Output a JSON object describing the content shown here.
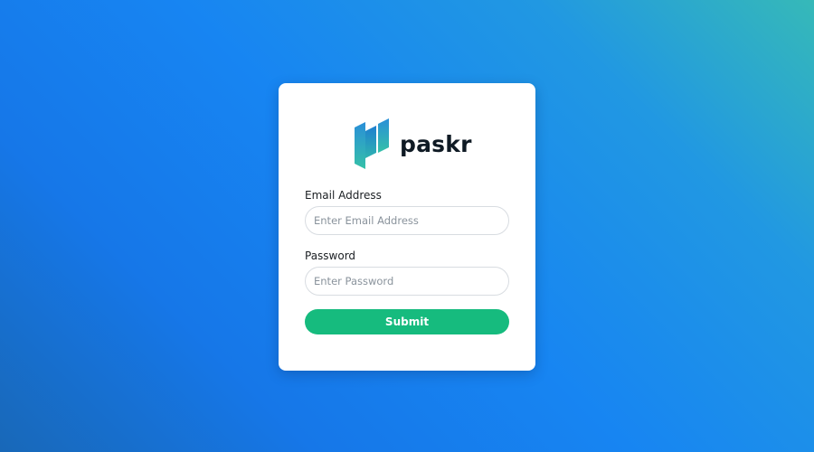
{
  "brand": {
    "name": "paskr",
    "logo_icon": "paskr-logo-icon",
    "colors": {
      "logo_top": "#2a8fd8",
      "logo_bottom": "#35c1a8",
      "text": "#0f1a24"
    }
  },
  "form": {
    "email_label": "Email Address",
    "email_placeholder": "Enter Email Address",
    "email_value": "",
    "password_label": "Password",
    "password_placeholder": "Enter Password",
    "password_value": "",
    "submit_label": "Submit",
    "submit_color": "#16bb7e"
  }
}
